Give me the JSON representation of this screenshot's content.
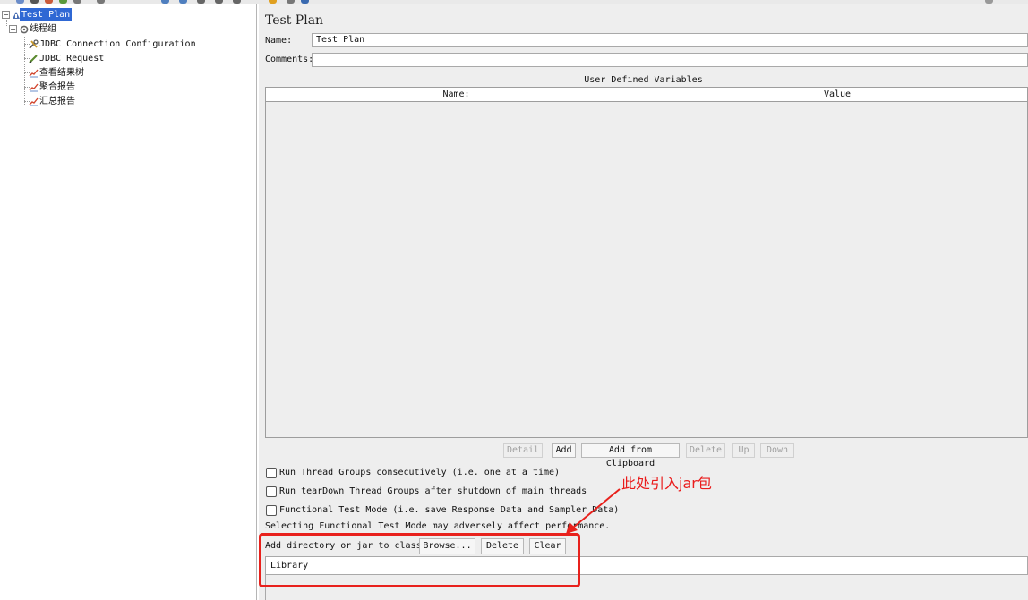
{
  "tree": {
    "root_label": "Test Plan",
    "thread_group_label": "线程组",
    "children": [
      {
        "label": "JDBC Connection Configuration",
        "icon": "wrench-icon"
      },
      {
        "label": "JDBC Request",
        "icon": "pen-icon"
      },
      {
        "label": "查看结果树",
        "icon": "chart-icon"
      },
      {
        "label": "聚合报告",
        "icon": "chart-icon"
      },
      {
        "label": "汇总报告",
        "icon": "chart-icon"
      }
    ]
  },
  "panel": {
    "title": "Test Plan",
    "name_label": "Name:",
    "name_value": "Test Plan",
    "comments_label": "Comments:",
    "comments_value": "",
    "udv": {
      "title": "User Defined Variables",
      "columns": [
        "Name:",
        "Value"
      ],
      "rows": []
    },
    "buttons": [
      {
        "label": "Detail",
        "enabled": false
      },
      {
        "label": "Add",
        "enabled": true
      },
      {
        "label": "Add from Clipboard",
        "enabled": true
      },
      {
        "label": "Delete",
        "enabled": false
      },
      {
        "label": "Up",
        "enabled": false
      },
      {
        "label": "Down",
        "enabled": false
      }
    ],
    "checkboxes": [
      {
        "label": "Run Thread Groups consecutively (i.e. one at a time)",
        "checked": false
      },
      {
        "label": "Run tearDown Thread Groups after shutdown of main threads",
        "checked": false
      },
      {
        "label": "Functional Test Mode (i.e. save Response Data and Sampler Data)",
        "checked": false
      }
    ],
    "functional_note": "Selecting Functional Test Mode may adversely affect performance.",
    "classpath": {
      "label": "Add directory or jar to classpath",
      "browse": "Browse...",
      "delete": "Delete",
      "clear": "Clear",
      "library_header": "Library"
    }
  },
  "annotation": {
    "text": "此处引入jar包",
    "color": "#e8211c"
  },
  "colors": {
    "selection": "#2f68d4",
    "panel_bg": "#eeeeee"
  }
}
